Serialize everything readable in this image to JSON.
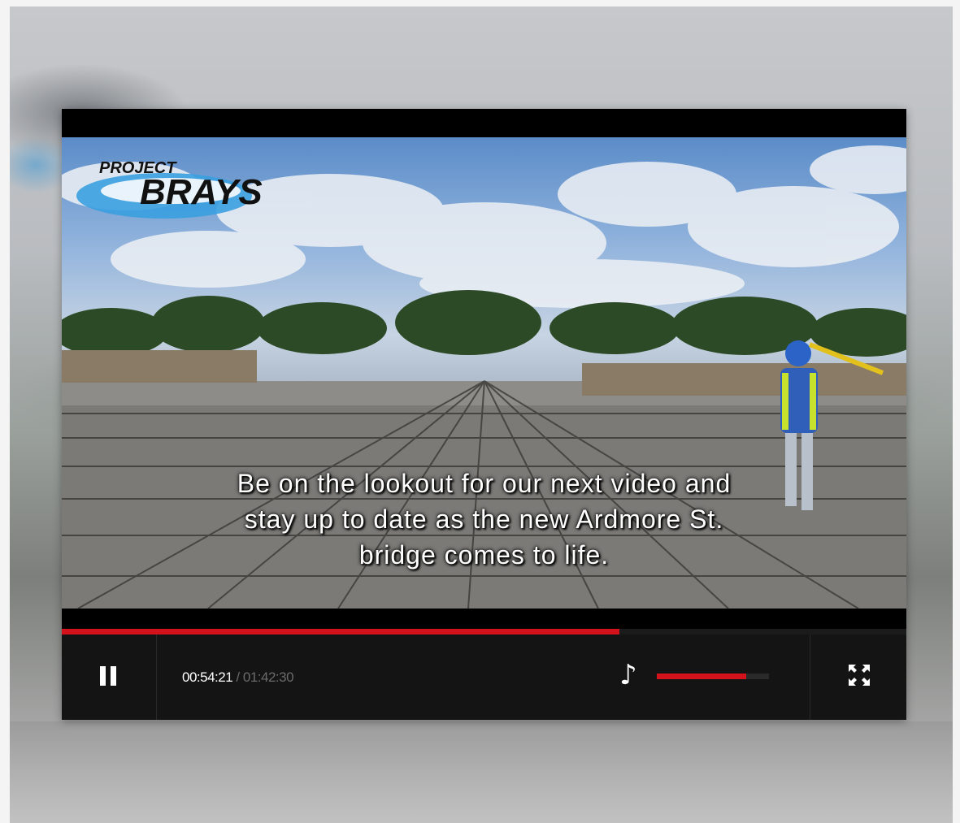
{
  "video": {
    "logo_top": "PROJECT",
    "logo_main": "BRAYS",
    "subtitle_lines": [
      "Be on the lookout for our next video and",
      "stay up to date as the new Ardmore St.",
      "bridge comes to life."
    ]
  },
  "controls": {
    "state": "playing",
    "pause_icon": "pause-icon",
    "current_time": "00:54:21",
    "separator": " / ",
    "total_time": "01:42:30",
    "progress_fraction": 0.66,
    "volume_icon": "music-note-icon",
    "volume_fraction": 0.8,
    "fullscreen_icon": "fullscreen-icon"
  },
  "colors": {
    "accent": "#d4121c",
    "control_bar": "#141414",
    "logo_blue": "#3aa0e0"
  }
}
